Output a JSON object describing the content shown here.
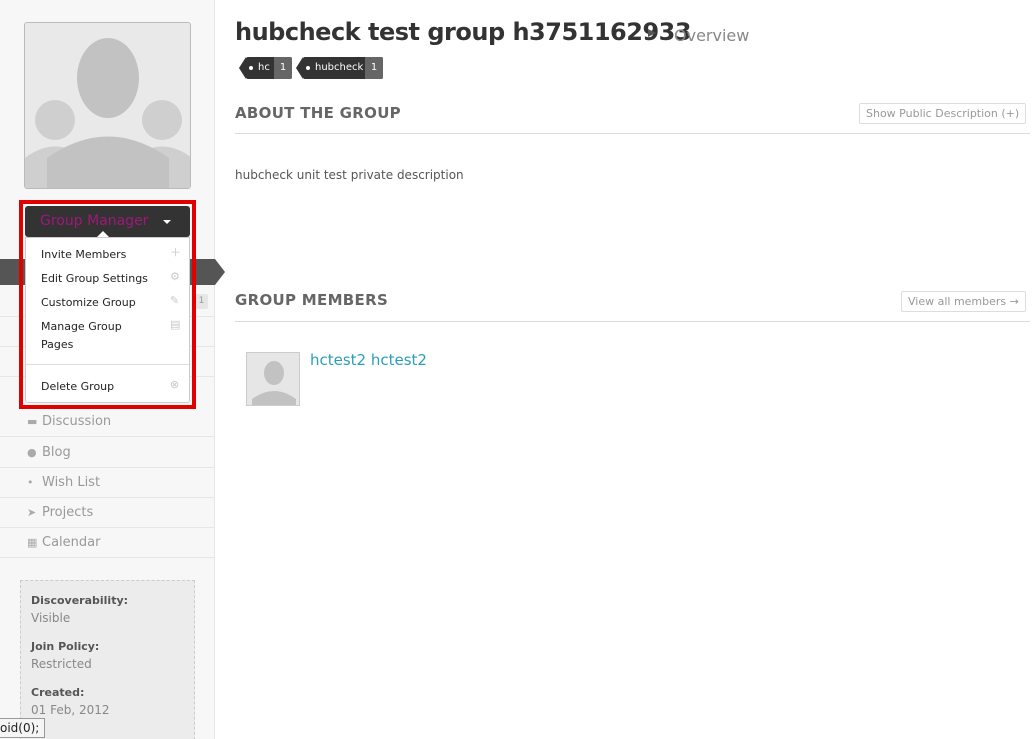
{
  "group": {
    "title": "hubcheck test group h3751162933",
    "section": "Overview",
    "tags": [
      {
        "label": "hc",
        "count": "1"
      },
      {
        "label": "hubcheck",
        "count": "1"
      }
    ]
  },
  "manager_menu": {
    "button_label": "Group Manager",
    "items": [
      {
        "label": "Invite Members",
        "icon": "plus-icon"
      },
      {
        "label": "Edit Group Settings",
        "icon": "gear-icon"
      },
      {
        "label": "Customize Group",
        "icon": "pencil-icon"
      },
      {
        "label": "Manage Group Pages",
        "icon": "file-icon"
      },
      {
        "label": "Delete Group",
        "icon": "close-circle-icon"
      }
    ]
  },
  "sidebar": {
    "count_badge": "1",
    "nav": [
      {
        "label": "Discussion",
        "icon": "comments-icon"
      },
      {
        "label": "Blog",
        "icon": "chat-bubble-icon"
      },
      {
        "label": "Wish List",
        "icon": "lightbulb-icon"
      },
      {
        "label": "Projects",
        "icon": "paper-plane-icon"
      },
      {
        "label": "Calendar",
        "icon": "calendar-icon"
      }
    ],
    "info": {
      "discoverability_label": "Discoverability:",
      "discoverability_value": "Visible",
      "join_policy_label": "Join Policy:",
      "join_policy_value": "Restricted",
      "created_label": "Created:",
      "created_value": "01 Feb, 2012"
    }
  },
  "about": {
    "heading": "ABOUT THE GROUP",
    "toggle_label": "Show Public Description (+)",
    "private_description": "hubcheck unit test private description"
  },
  "members": {
    "heading": "GROUP MEMBERS",
    "view_all_label": "View all members →",
    "list": [
      {
        "name": "hctest2 hctest2"
      }
    ]
  },
  "status_tooltip": "oid(0);"
}
